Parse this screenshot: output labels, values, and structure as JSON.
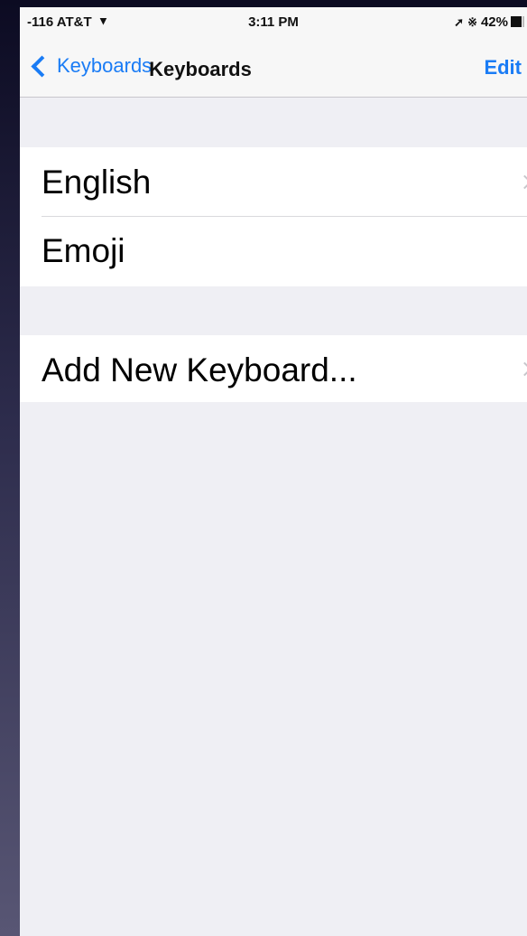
{
  "status_bar": {
    "signal": "-116 AT&T",
    "time": "3:11 PM",
    "battery": "42%"
  },
  "nav": {
    "back_label": "Keyboards",
    "title": "Keyboards",
    "edit_label": "Edit"
  },
  "keyboards": [
    {
      "label": "English"
    },
    {
      "label": "Emoji"
    }
  ],
  "add_keyboard": {
    "label": "Add New Keyboard..."
  },
  "colors": {
    "accent": "#1a7cf5",
    "background": "#efeff4",
    "cell": "#ffffff"
  }
}
